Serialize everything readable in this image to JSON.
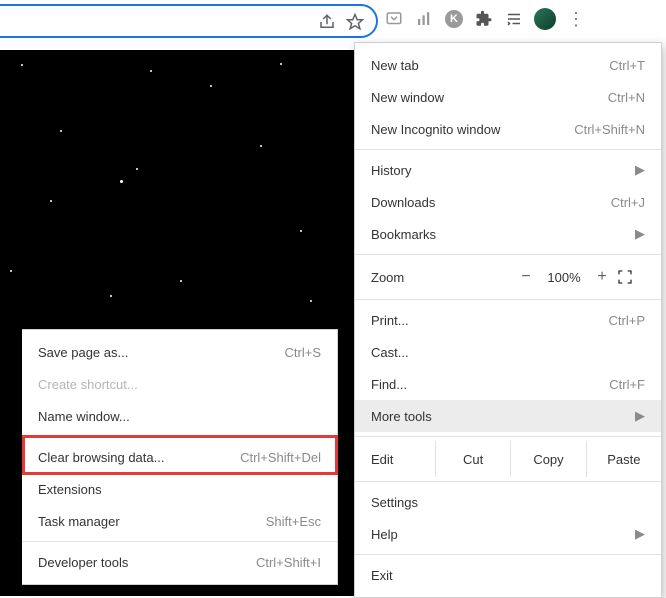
{
  "mainMenu": {
    "newTab": {
      "label": "New tab",
      "shortcut": "Ctrl+T"
    },
    "newWindow": {
      "label": "New window",
      "shortcut": "Ctrl+N"
    },
    "newIncognito": {
      "label": "New Incognito window",
      "shortcut": "Ctrl+Shift+N"
    },
    "history": {
      "label": "History"
    },
    "downloads": {
      "label": "Downloads",
      "shortcut": "Ctrl+J"
    },
    "bookmarks": {
      "label": "Bookmarks"
    },
    "zoom": {
      "label": "Zoom",
      "minus": "−",
      "value": "100%",
      "plus": "+"
    },
    "print": {
      "label": "Print...",
      "shortcut": "Ctrl+P"
    },
    "cast": {
      "label": "Cast..."
    },
    "find": {
      "label": "Find...",
      "shortcut": "Ctrl+F"
    },
    "moreTools": {
      "label": "More tools"
    },
    "edit": {
      "label": "Edit",
      "cut": "Cut",
      "copy": "Copy",
      "paste": "Paste"
    },
    "settings": {
      "label": "Settings"
    },
    "help": {
      "label": "Help"
    },
    "exit": {
      "label": "Exit"
    }
  },
  "subMenu": {
    "savePage": {
      "label": "Save page as...",
      "shortcut": "Ctrl+S"
    },
    "createShortcut": {
      "label": "Create shortcut..."
    },
    "nameWindow": {
      "label": "Name window..."
    },
    "clearData": {
      "label": "Clear browsing data...",
      "shortcut": "Ctrl+Shift+Del"
    },
    "extensions": {
      "label": "Extensions"
    },
    "taskManager": {
      "label": "Task manager",
      "shortcut": "Shift+Esc"
    },
    "devTools": {
      "label": "Developer tools",
      "shortcut": "Ctrl+Shift+I"
    }
  },
  "icons": {
    "share": "share-icon",
    "star": "star-icon",
    "pocket": "pocket-icon",
    "analytics": "analytics-icon",
    "k": "K",
    "puzzle": "puzzle-icon",
    "playlist": "playlist-icon",
    "avatar": "avatar",
    "kebab": "⋮",
    "fullscreen": "fullscreen-icon",
    "submenuArrow": "▶"
  }
}
